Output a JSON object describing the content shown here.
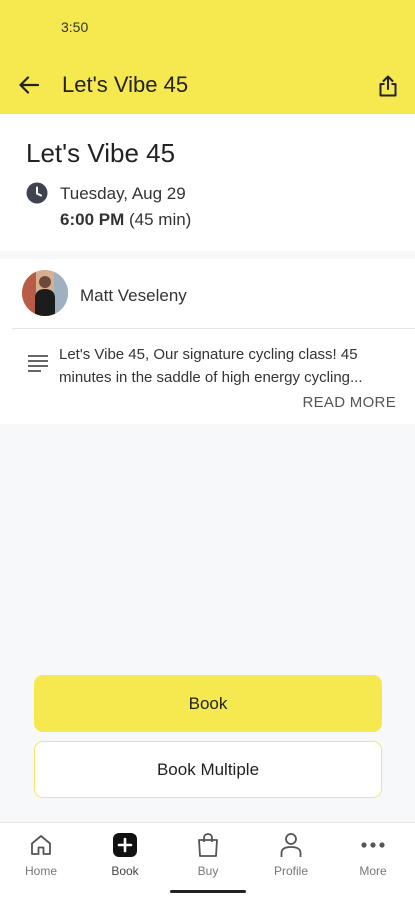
{
  "status_bar": {
    "time": "3:50"
  },
  "header": {
    "title": "Let's Vibe 45",
    "back_icon": "arrow-left-icon",
    "share_icon": "share-icon",
    "background": "#f6e94f"
  },
  "class_info": {
    "title": "Let's Vibe 45",
    "date": "Tuesday, Aug 29",
    "time": "6:00 PM",
    "duration": "(45 min)"
  },
  "instructor": {
    "name": "Matt Veseleny"
  },
  "description": {
    "text": "Let's Vibe 45, Our signature cycling class! 45 minutes in the saddle of high energy cycling...",
    "read_more": "READ MORE"
  },
  "actions": {
    "book": "Book",
    "book_multiple": "Book Multiple"
  },
  "tabbar": {
    "items": [
      {
        "label": "Home",
        "icon": "home-icon"
      },
      {
        "label": "Book",
        "icon": "plus-square-icon"
      },
      {
        "label": "Buy",
        "icon": "shopping-bag-icon"
      },
      {
        "label": "Profile",
        "icon": "person-icon"
      },
      {
        "label": "More",
        "icon": "more-dots-icon"
      }
    ]
  }
}
